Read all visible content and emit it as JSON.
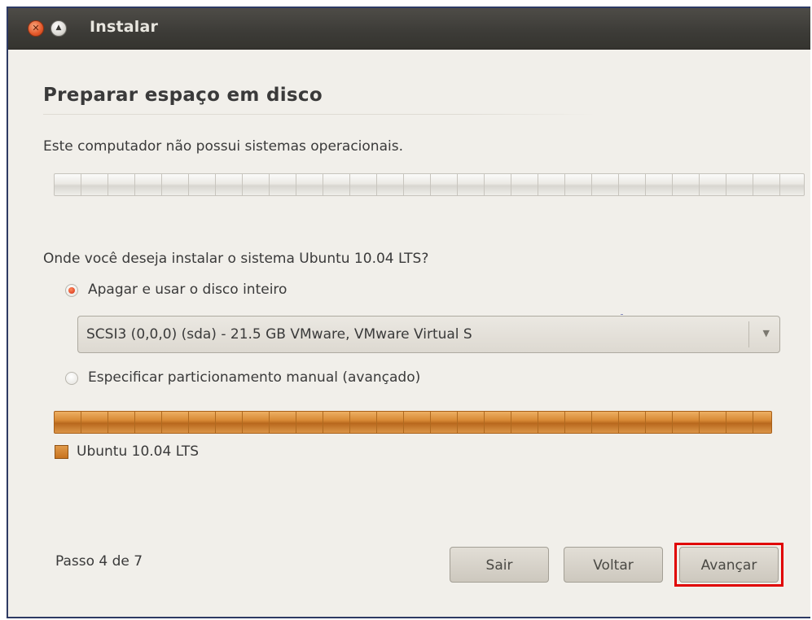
{
  "window": {
    "title": "Instalar"
  },
  "page": {
    "title": "Preparar espaço em disco",
    "os_status": "Este computador não possui sistemas operacionais.",
    "question": "Onde você deseja instalar o sistema Ubuntu 10.04 LTS?"
  },
  "options": {
    "erase": {
      "label": "Apagar e usar o disco inteiro",
      "checked": true
    },
    "manual": {
      "label": "Especificar particionamento manual (avançado)",
      "checked": false
    }
  },
  "disk_select": {
    "value": "SCSI3 (0,0,0) (sda) - 21.5 GB VMware, VMware Virtual S"
  },
  "partition_preview": {
    "legend_label": "Ubuntu 10.04 LTS",
    "color": "#d88a36"
  },
  "footer": {
    "step": "Passo 4 de 7",
    "quit_label": "Sair",
    "back_label": "Voltar",
    "forward_label": "Avançar"
  },
  "colors": {
    "highlight": "#e00000",
    "accent_radio": "#e0482a",
    "titlebar": "#3c3b37"
  }
}
